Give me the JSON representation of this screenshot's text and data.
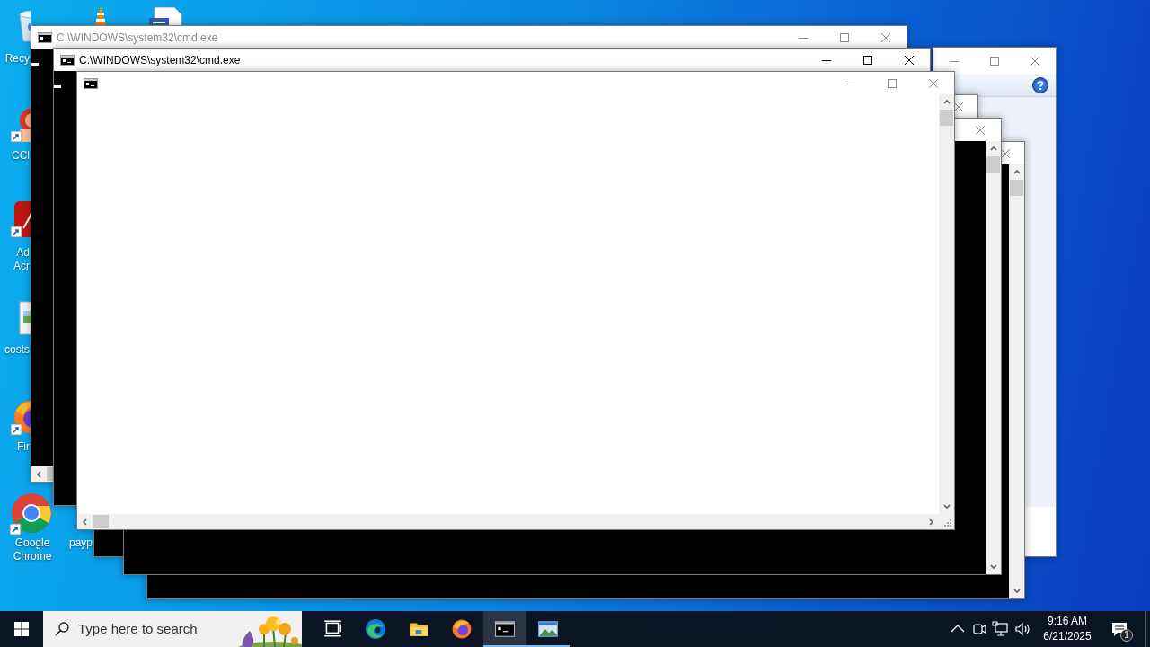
{
  "desktop": {
    "icons": [
      {
        "kind": "bin",
        "label_lines": [
          "Recy"
        ]
      },
      {
        "kind": "cone"
      },
      {
        "kind": "document"
      },
      {
        "kind": "ccleaner",
        "label_lines": [
          "CCl"
        ]
      },
      {
        "kind": "acrobat",
        "label_lines": [
          "Ad",
          "Acr"
        ]
      },
      {
        "kind": "image_file",
        "label_lines": [
          "costs"
        ]
      },
      {
        "kind": "firefox",
        "label_lines": [
          "Fir"
        ]
      },
      {
        "kind": "chrome",
        "label_lines": [
          "Google",
          "Chrome"
        ]
      },
      {
        "kind": "label_only",
        "label_lines": [
          "payp"
        ]
      }
    ]
  },
  "windows": [
    {
      "kind": "dialog",
      "active": false,
      "controls": [
        {
          "kind": "minimize"
        },
        {
          "kind": "maximize"
        },
        {
          "kind": "close"
        }
      ],
      "help_button": true
    },
    {
      "kind": "console",
      "active": false,
      "controls": [
        {
          "kind": "close"
        }
      ],
      "scrollbars": [
        {
          "kind": "vertical"
        }
      ]
    },
    {
      "kind": "console",
      "active": false,
      "controls": [
        {
          "kind": "close"
        }
      ]
    },
    {
      "kind": "console",
      "active": false,
      "controls": [
        {
          "kind": "close"
        }
      ],
      "scrollbars": [
        {
          "kind": "vertical"
        }
      ]
    },
    {
      "kind": "console",
      "title": "C:\\WINDOWS\\system32\\cmd.exe",
      "active": false,
      "controls": [
        {
          "kind": "minimize"
        },
        {
          "kind": "maximize"
        },
        {
          "kind": "close"
        }
      ],
      "cursor": true,
      "scrollbars": [
        {
          "kind": "horizontal"
        }
      ]
    },
    {
      "kind": "console",
      "title": "C:\\WINDOWS\\system32\\cmd.exe",
      "active": true,
      "controls": [
        {
          "kind": "minimize"
        },
        {
          "kind": "maximize"
        },
        {
          "kind": "close"
        }
      ],
      "cursor": true
    },
    {
      "kind": "blank",
      "active": false,
      "controls": [
        {
          "kind": "minimize"
        },
        {
          "kind": "maximize"
        },
        {
          "kind": "close"
        }
      ],
      "scrollbars": [
        {
          "kind": "vertical"
        },
        {
          "kind": "horizontal"
        }
      ]
    }
  ],
  "taskbar": {
    "search": {
      "placeholder": "Type here to search"
    },
    "apps": [
      {
        "kind": "task_view",
        "selected": false,
        "running": false
      },
      {
        "kind": "edge",
        "selected": false,
        "running": false
      },
      {
        "kind": "explorer",
        "selected": false,
        "running": false
      },
      {
        "kind": "firefox",
        "selected": false,
        "running": false
      },
      {
        "kind": "console",
        "selected": true,
        "running": true
      },
      {
        "kind": "photos",
        "selected": false,
        "running": true
      }
    ],
    "clock": {
      "time": "9:16 AM",
      "date": "6/21/2025"
    },
    "notifications": {
      "count": "1"
    }
  }
}
